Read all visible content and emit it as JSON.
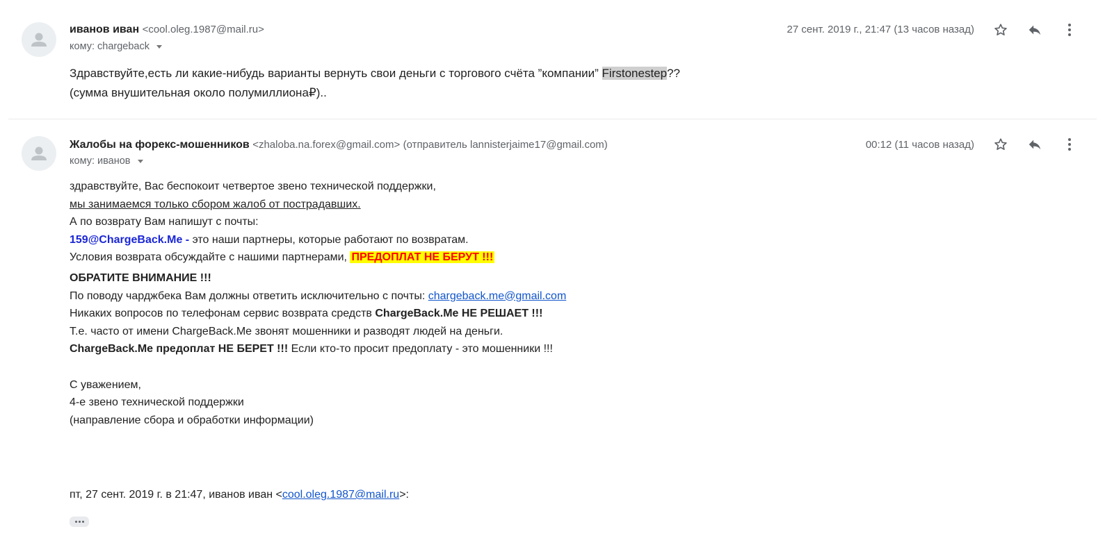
{
  "messages": [
    {
      "sender_name": "иванов иван",
      "sender_email": "<cool.oleg.1987@mail.ru>",
      "to_prefix": "кому:",
      "to_name": "chargeback",
      "date": "27 сент. 2019 г., 21:47 (13 часов назад)",
      "body": {
        "line1_before": "Здравствуйте,есть ли какие-нибудь варианты вернуть свои деньги с торгового счёта ”компании” ",
        "line1_highlight": "Firstonestep",
        "line1_after": "??",
        "line2": "(сумма внушительная около полумиллиона₽).."
      }
    },
    {
      "sender_name": "Жалобы на форекс-мошенников",
      "sender_email": "<zhaloba.na.forex@gmail.com>",
      "via": "(отправитель lannisterjaime17@gmail.com)",
      "to_prefix": "кому:",
      "to_name": "иванов",
      "date": "00:12 (11 часов назад)",
      "body": {
        "l1": "здравствуйте, Вас беспокоит четвертое звено технической поддержки,",
        "l2": "мы занимаемся только сбором жалоб от пострадавших.",
        "l3": "А по возврату Вам напишут с почты:",
        "l4_email": "159@ChargeBack.Me -",
        "l4_rest": " это наши партнеры, которые работают по возвратам.",
        "l5_text": "Условия возврата обсуждайте с нашими партнерами, ",
        "l5_warn": "ПРЕДОПЛАТ НЕ БЕРУТ !!!",
        "l6": "ОБРАТИТЕ ВНИМАНИЕ !!!",
        "l7_text": "По поводу чарджбека Вам должны ответить исключительно с почты: ",
        "l7_link": "chargeback.me@gmail.com",
        "l8_text": "Никаких вопросов по телефонам сервис возврата средств ",
        "l8_bold": "ChargeBack.Me НЕ РЕШАЕТ !!!",
        "l9": "Т.е. часто от имени ChargeBack.Me звонят мошенники и разводят людей на деньги.",
        "l10_bold": "ChargeBack.Me предоплат НЕ БЕРЕТ !!!",
        "l10_rest": " Если кто-то просит предоплату - это мошенники !!!",
        "sig1": "С уважением,",
        "sig2": "4-е звено технической поддержки",
        "sig3": "(направление сбора и обработки информации)"
      },
      "quote": {
        "prefix": "пт, 27 сент. 2019 г. в 21:47, иванов иван <",
        "email": "cool.oleg.1987@mail.ru",
        "suffix": ">:"
      }
    }
  ],
  "icons": [
    "avatar-icon",
    "star-icon",
    "reply-icon",
    "more-vert-icon",
    "caret-down-icon",
    "ellipsis-icon"
  ],
  "colors": {
    "warn_bg": "#ffff00",
    "warn_text": "#ff0000",
    "partner_email": "#1a26d6",
    "link": "#1155cc",
    "highlight": "#cfcfcf"
  }
}
